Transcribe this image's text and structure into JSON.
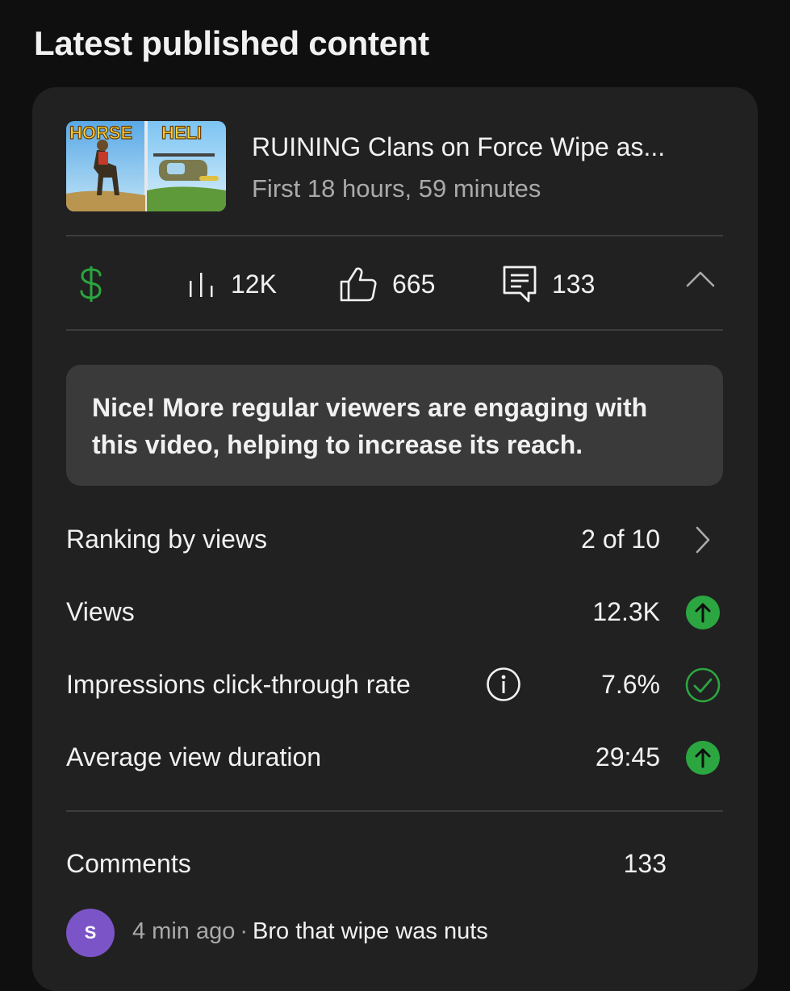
{
  "section_title": "Latest published content",
  "video": {
    "thumbnail_text_left": "HORSE",
    "thumbnail_text_right": "HELI",
    "title": "RUINING Clans on Force Wipe as...",
    "subtitle": "First 18 hours, 59 minutes"
  },
  "stats": {
    "revenue_icon": "dollar-icon",
    "views": "12K",
    "likes": "665",
    "comments": "133"
  },
  "insight": "Nice! More regular viewers are engaging with this video, helping to increase its reach.",
  "metrics": [
    {
      "label": "Ranking by views",
      "value": "2 of 10",
      "icon": "chevron-right-icon"
    },
    {
      "label": "Views",
      "value": "12.3K",
      "icon": "arrow-up-circle-icon"
    },
    {
      "label": "Impressions click-through rate",
      "value": "7.6%",
      "icon": "check-circle-icon"
    },
    {
      "label": "Average view duration",
      "value": "29:45",
      "icon": "arrow-up-circle-icon"
    }
  ],
  "comments_section": {
    "label": "Comments",
    "count": "133",
    "latest": {
      "avatar_letter": "S",
      "time": "4 min ago",
      "separator": "·",
      "text": "Bro that wipe was nuts"
    }
  },
  "colors": {
    "background": "#0f0f0f",
    "card": "#212121",
    "insight_box": "#3a3a3a",
    "accent_green": "#3ea6ff",
    "positive_green": "#2ba640",
    "avatar_purple": "#7b55c7"
  }
}
